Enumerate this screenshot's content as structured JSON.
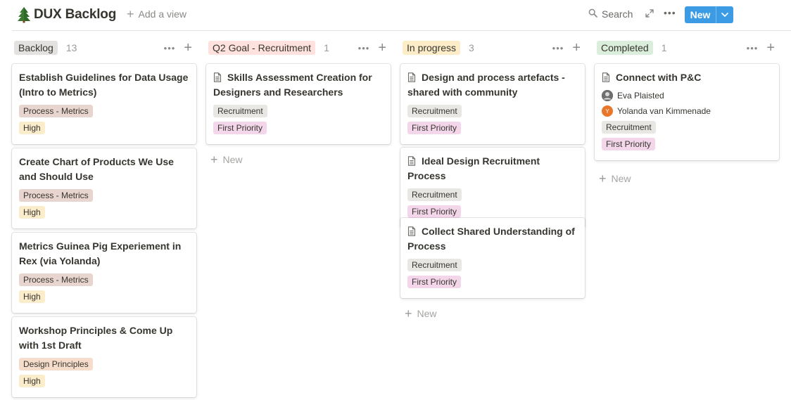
{
  "header": {
    "title": "DUX Backlog",
    "title_icon": "tree-icon",
    "add_view_label": "Add a view",
    "search_label": "Search",
    "new_button_label": "New",
    "accent_color": "#3b9ce5"
  },
  "columns": [
    {
      "status": "Backlog",
      "count": "13",
      "status_color": "#e3e2e0",
      "cards": [
        {
          "title": "Establish Guidelines for Data Usage (Intro to Metrics)",
          "tags": [
            "Process - Metrics",
            "High"
          ]
        },
        {
          "title": "Create Chart of Products We Use and Should Use",
          "tags": [
            "Process - Metrics",
            "High"
          ]
        },
        {
          "title": "Metrics Guinea Pig Experiement in Rex (via Yolanda)",
          "tags": [
            "Process - Metrics",
            "High"
          ]
        },
        {
          "title": "Workshop Principles & Come Up with 1st Draft",
          "tags": [
            "Design Principles",
            "High"
          ]
        }
      ]
    },
    {
      "status": "Q2 Goal - Recruitment",
      "count": "1",
      "status_color": "#ffe2dd",
      "new_label": "New",
      "cards": [
        {
          "title": "Skills Assessment Creation for Designers and Researchers",
          "tags": [
            "Recruitment",
            "First Priority"
          ]
        }
      ]
    },
    {
      "status": "In progress",
      "count": "3",
      "status_color": "#fdecc8",
      "new_label": "New",
      "cards": [
        {
          "title": "Design and process artefacts - shared with community",
          "tags": [
            "Recruitment",
            "First Priority"
          ]
        },
        {
          "title": "Ideal Design Recruitment Process",
          "tags": [
            "Recruitment",
            "First Priority"
          ]
        },
        {
          "title": "Collect Shared Understanding of Process",
          "tags": [
            "Recruitment",
            "First Priority"
          ]
        }
      ]
    },
    {
      "status": "Completed",
      "count": "1",
      "status_color": "#dbeddb",
      "new_label": "New",
      "cards": [
        {
          "title": "Connect with P&C",
          "people": [
            "Eva Plaisted",
            "Yolanda van Kimmenade"
          ],
          "avatar_initial": "Y",
          "tags": [
            "Recruitment",
            "First Priority"
          ]
        }
      ]
    }
  ],
  "tag_colors": {
    "Process - Metrics": "#e8d5cf",
    "Design Principles": "#f5dccb",
    "High": "#fbeccb",
    "Recruitment": "#e8e7e4",
    "First Priority": "#f3d6ea"
  }
}
